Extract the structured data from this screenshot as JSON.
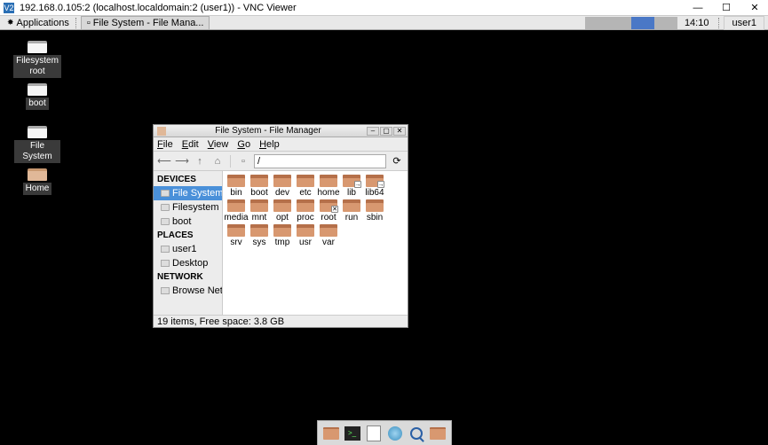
{
  "vnc": {
    "title": "192.168.0.105:2 (localhost.localdomain:2 (user1)) - VNC Viewer"
  },
  "panel": {
    "applications": "Applications",
    "task": "File System - File Mana...",
    "clock": "14:10",
    "user": "user1"
  },
  "desktop_icons": [
    {
      "label": "Filesystem root",
      "type": "drive"
    },
    {
      "label": "boot",
      "type": "drive"
    },
    {
      "label": "File System",
      "type": "drive"
    },
    {
      "label": "Home",
      "type": "home"
    }
  ],
  "fm": {
    "title": "File System - File Manager",
    "menus": {
      "file": "File",
      "edit": "Edit",
      "view": "View",
      "go": "Go",
      "help": "Help"
    },
    "path": "/",
    "sidebar": {
      "devices_label": "DEVICES",
      "places_label": "PLACES",
      "network_label": "NETWORK",
      "devices": [
        {
          "label": "File System",
          "selected": true
        },
        {
          "label": "Filesystem root",
          "selected": false
        },
        {
          "label": "boot",
          "selected": false
        }
      ],
      "places": [
        {
          "label": "user1"
        },
        {
          "label": "Desktop"
        }
      ],
      "network": [
        {
          "label": "Browse Network"
        }
      ]
    },
    "folders": [
      {
        "name": "bin"
      },
      {
        "name": "boot"
      },
      {
        "name": "dev"
      },
      {
        "name": "etc"
      },
      {
        "name": "home"
      },
      {
        "name": "lib",
        "badge": "→"
      },
      {
        "name": "lib64",
        "badge": "→"
      },
      {
        "name": "media"
      },
      {
        "name": "mnt"
      },
      {
        "name": "opt"
      },
      {
        "name": "proc"
      },
      {
        "name": "root",
        "badge": "✕"
      },
      {
        "name": "run"
      },
      {
        "name": "sbin"
      },
      {
        "name": "srv"
      },
      {
        "name": "sys"
      },
      {
        "name": "tmp"
      },
      {
        "name": "usr"
      },
      {
        "name": "var"
      }
    ],
    "status": "19 items, Free space: 3.8 GB"
  }
}
